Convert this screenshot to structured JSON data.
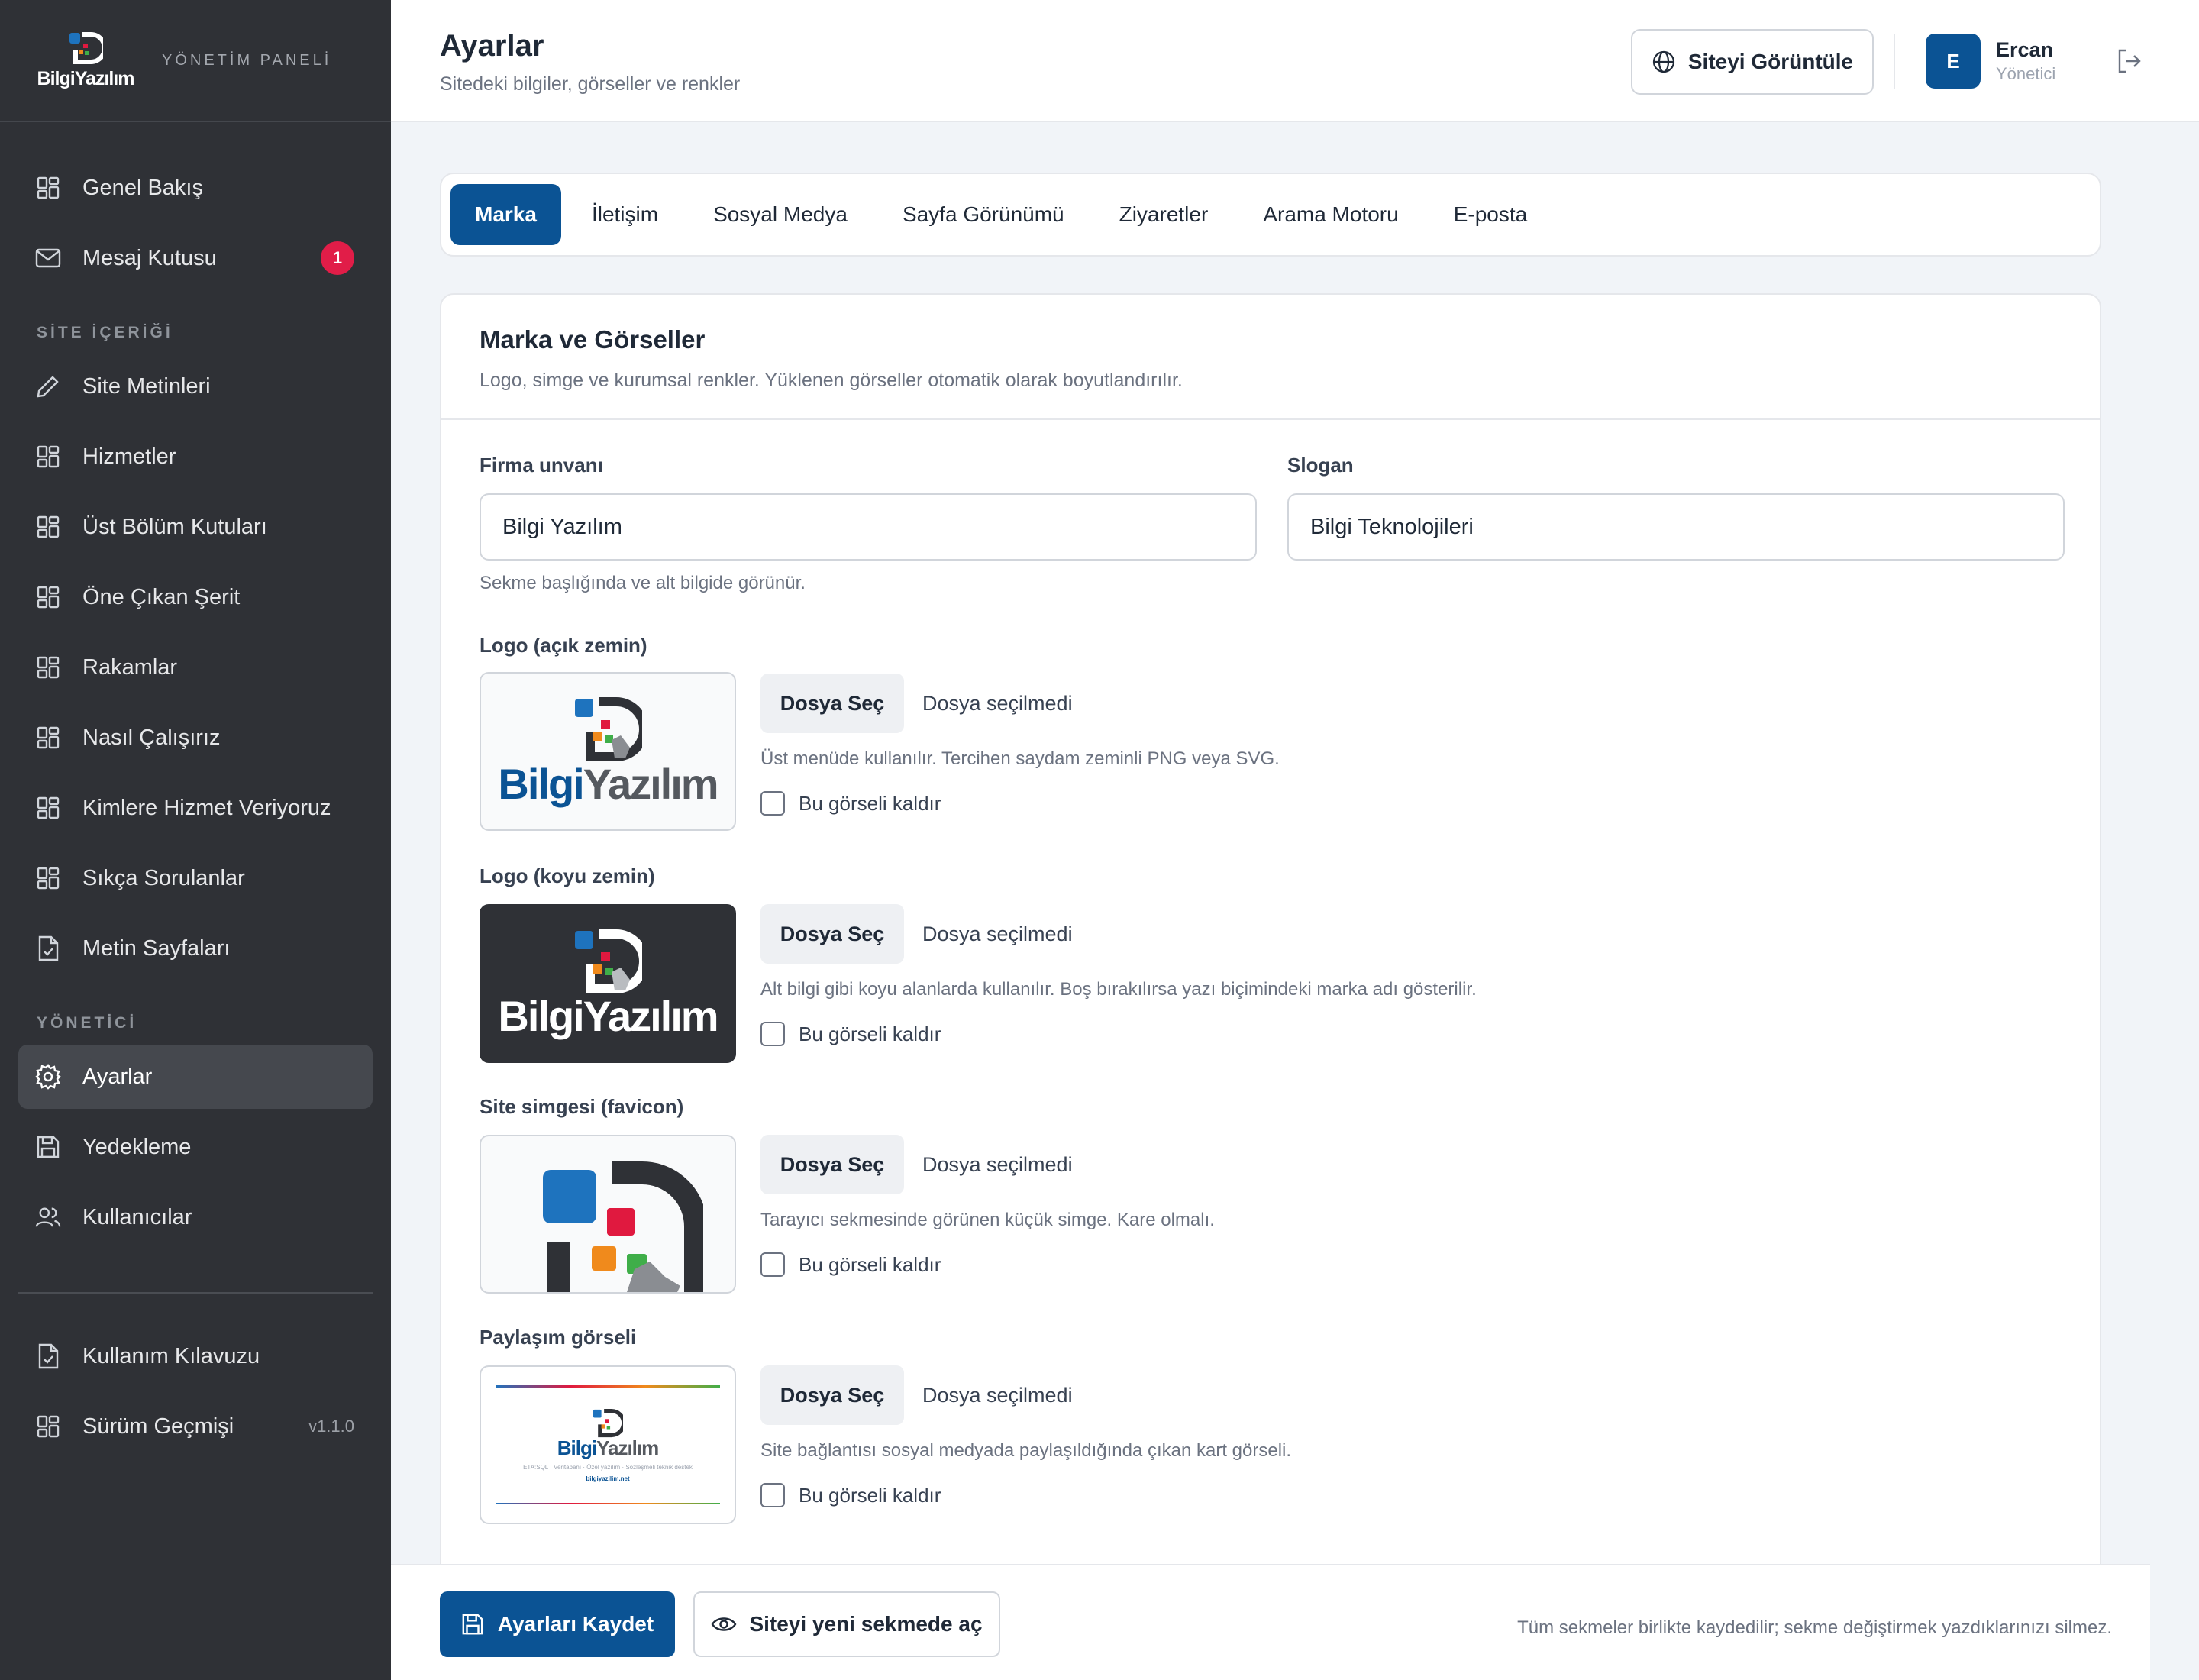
{
  "sidebar": {
    "brand_word": "BilgiYazılım",
    "panel_label": "YÖNETİM PANELİ",
    "top_items": [
      {
        "label": "Genel Bakış",
        "icon": "grid-icon"
      },
      {
        "label": "Mesaj Kutusu",
        "icon": "mail-icon",
        "badge": "1"
      }
    ],
    "section_content": "SİTE İÇERİĞİ",
    "content_items": [
      {
        "label": "Site Metinleri",
        "icon": "pencil-icon"
      },
      {
        "label": "Hizmetler",
        "icon": "grid-icon"
      },
      {
        "label": "Üst Bölüm Kutuları",
        "icon": "grid-icon"
      },
      {
        "label": "Öne Çıkan Şerit",
        "icon": "grid-icon"
      },
      {
        "label": "Rakamlar",
        "icon": "grid-icon"
      },
      {
        "label": "Nasıl Çalışırız",
        "icon": "grid-icon"
      },
      {
        "label": "Kimlere Hizmet Veriyoruz",
        "icon": "grid-icon"
      },
      {
        "label": "Sıkça Sorulanlar",
        "icon": "grid-icon"
      },
      {
        "label": "Metin Sayfaları",
        "icon": "document-icon"
      }
    ],
    "section_admin": "YÖNETİCİ",
    "admin_items": [
      {
        "label": "Ayarlar",
        "icon": "gear-icon",
        "active": true
      },
      {
        "label": "Yedekleme",
        "icon": "save-icon"
      },
      {
        "label": "Kullanıcılar",
        "icon": "users-icon"
      }
    ],
    "bottom_items": [
      {
        "label": "Kullanım Kılavuzu",
        "icon": "document-icon"
      },
      {
        "label": "Sürüm Geçmişi",
        "icon": "grid-icon",
        "version": "v1.1.0"
      }
    ]
  },
  "header": {
    "title": "Ayarlar",
    "subtitle": "Sitedeki bilgiler, görseller ve renkler",
    "view_site": "Siteyi Görüntüle",
    "avatar_initial": "E",
    "user_name": "Ercan",
    "user_role": "Yönetici"
  },
  "tabs": [
    "Marka",
    "İletişim",
    "Sosyal Medya",
    "Sayfa Görünümü",
    "Ziyaretler",
    "Arama Motoru",
    "E-posta"
  ],
  "card": {
    "title": "Marka ve Görseller",
    "description": "Logo, simge ve kurumsal renkler. Yüklenen görseller otomatik olarak boyutlandırılır.",
    "company_label": "Firma unvanı",
    "company_value": "Bilgi Yazılım",
    "slogan_label": "Slogan",
    "slogan_value": "Bilgi Teknolojileri",
    "company_hint": "Sekme başlığında ve alt bilgide görünür.",
    "file_button": "Dosya Seç",
    "file_none": "Dosya seçilmedi",
    "remove_label": "Bu görseli kaldır",
    "logo_word_1": "Bilgi",
    "logo_word_2": "Yazılım",
    "share_caption": "ETA:SQL · Veritabanı · Özel yazılım · Sözleşmeli teknik destek",
    "share_url": "bilgiyazilim.net",
    "images": [
      {
        "label": "Logo (açık zemin)",
        "hint": "Üst menüde kullanılır. Tercihen saydam zeminli PNG veya SVG."
      },
      {
        "label": "Logo (koyu zemin)",
        "hint": "Alt bilgi gibi koyu alanlarda kullanılır. Boş bırakılırsa yazı biçimindeki marka adı gösterilir."
      },
      {
        "label": "Site simgesi (favicon)",
        "hint": "Tarayıcı sekmesinde görünen küçük simge. Kare olmalı."
      },
      {
        "label": "Paylaşım görseli",
        "hint": "Site bağlantısı sosyal medyada paylaşıldığında çıkan kart görseli."
      }
    ]
  },
  "footer": {
    "save": "Ayarları Kaydet",
    "open_site": "Siteyi yeni sekmede aç",
    "note": "Tüm sekmeler birlikte kaydedilir; sekme değiştirmek yazdıklarınızı silmez."
  },
  "colors": {
    "brand_blue": "#0b5394",
    "sidebar_bg": "#2f3136",
    "badge_red": "#e11d48",
    "logo_blue": "#1e73be",
    "logo_red": "#e0193f",
    "logo_orange": "#f08a1c",
    "logo_green": "#3fae49"
  }
}
